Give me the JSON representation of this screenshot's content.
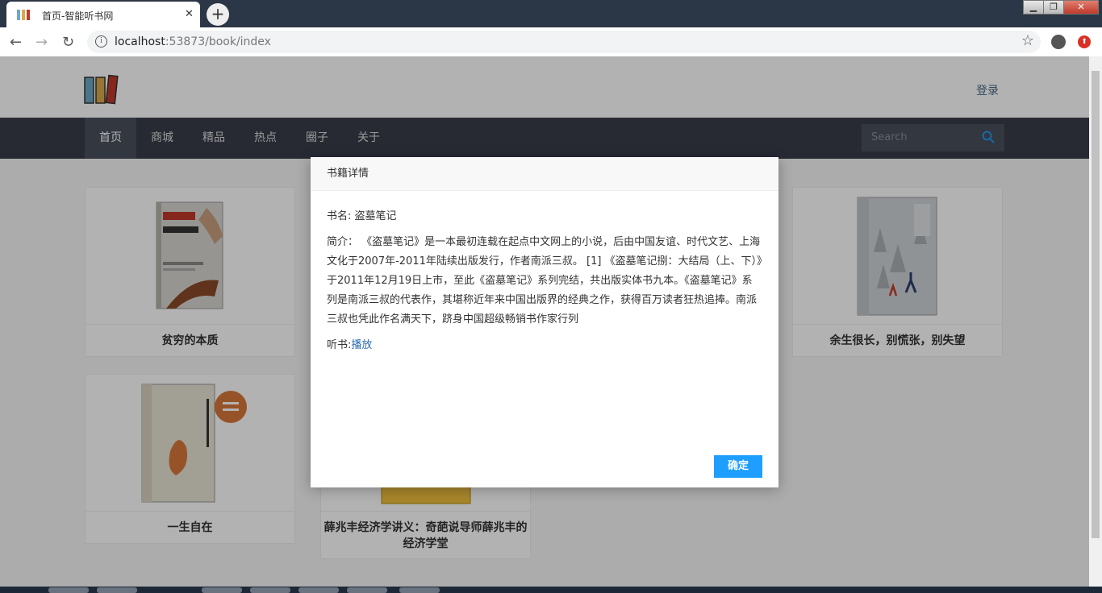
{
  "browser": {
    "tab_title": "首页-智能听书网",
    "tab_close": "✕",
    "new_tab": "+",
    "url_host": "localhost",
    "url_path": ":53873/book/index",
    "win_min": "▁",
    "win_max": "❐",
    "win_close": "✕"
  },
  "site": {
    "login": "登录",
    "nav": [
      "首页",
      "商城",
      "精品",
      "热点",
      "圈子",
      "关于"
    ],
    "search_placeholder": "Search"
  },
  "books": [
    {
      "title": "贫穷的本质",
      "cover_color": "#d8d6d0",
      "accent": "#c0392b"
    },
    {
      "title": "余生很长，别慌张，别失望",
      "cover_color": "#cfd3d6",
      "accent": "#7f8c8d"
    },
    {
      "title": "一生自在",
      "cover_color": "#e8e4d6",
      "accent": "#d9773a"
    },
    {
      "title": "薛兆丰经济学讲义：奇葩说导师薛兆丰的经济学堂",
      "cover_color": "#f0c040",
      "accent": "#e6a817"
    }
  ],
  "modal": {
    "header": "书籍详情",
    "name_line": "书名: 盗墓笔记",
    "intro": "简介： 《盗墓笔记》是一本最初连载在起点中文网上的小说，后由中国友谊、时代文艺、上海文化于2007年-2011年陆续出版发行，作者南派三叔。 [1] 《盗墓笔记捌：大结局（上、下）》于2011年12月19日上市，至此《盗墓笔记》系列完结，共出版实体书九本。《盗墓笔记》系列是南派三叔的代表作，其堪称近年来中国出版界的经典之作，获得百万读者狂热追捧。南派三叔也凭此作名满天下，跻身中国超级畅销书作家行列",
    "listen_label": "听书:",
    "listen_link": "播放",
    "ok_button": "确定"
  }
}
